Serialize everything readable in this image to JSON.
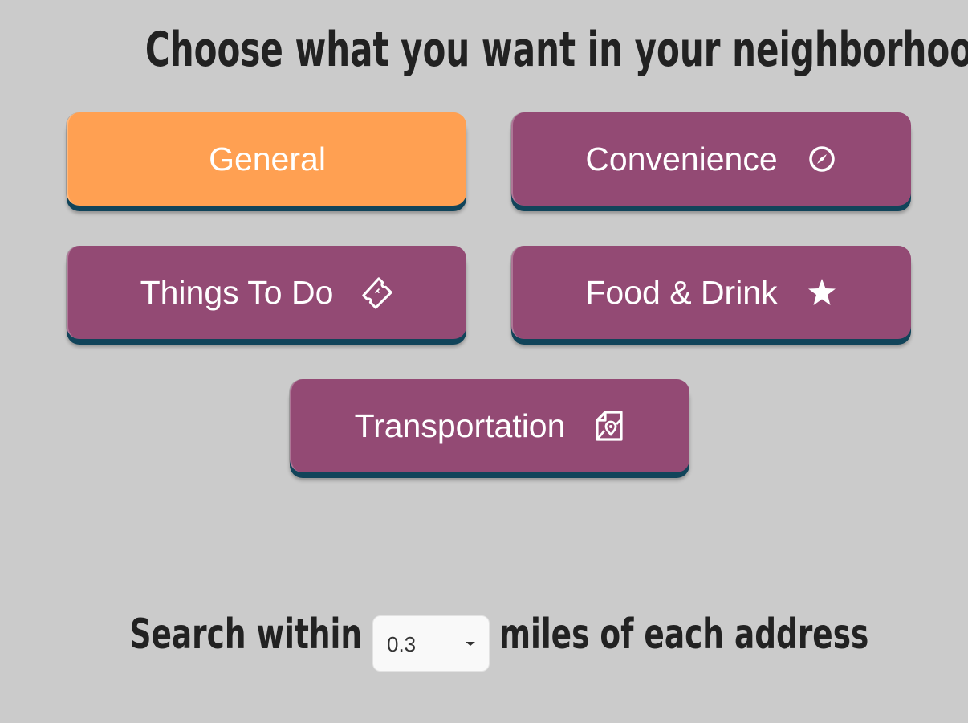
{
  "title": "Choose what you want in your neighborhood",
  "categories": [
    {
      "label": "General",
      "icon": "",
      "selected": true
    },
    {
      "label": "Convenience",
      "icon": "compass-icon",
      "selected": false
    },
    {
      "label": "Things To Do",
      "icon": "ticket-icon",
      "selected": false
    },
    {
      "label": "Food & Drink",
      "icon": "star-icon",
      "selected": false
    },
    {
      "label": "Transportation",
      "icon": "map-pin-icon",
      "selected": false
    }
  ],
  "search": {
    "prefix": "Search within",
    "distance": "0.3",
    "suffix": "miles of each address"
  },
  "colors": {
    "background": "#cbcbcb",
    "selected": "#ffa052",
    "unselected": "#934a74",
    "button_shadow": "#11445a",
    "heading": "#222222"
  }
}
